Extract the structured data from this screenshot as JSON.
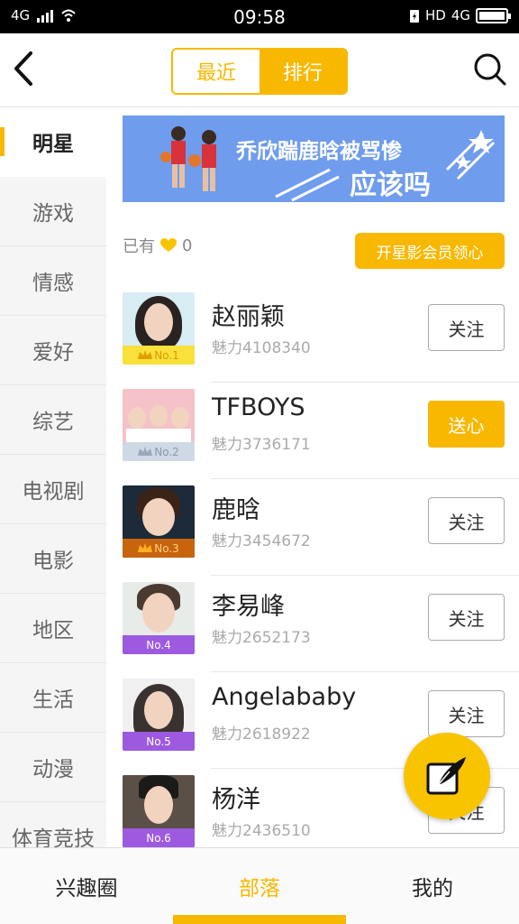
{
  "status_bar": {
    "network": "4G",
    "time": "09:58",
    "hd": "HD",
    "network_right": "4G"
  },
  "header": {
    "segments": [
      {
        "label": "最近",
        "active": false
      },
      {
        "label": "排行",
        "active": true
      }
    ],
    "icons": [
      "back-arrow-icon",
      "search-icon"
    ]
  },
  "sidebar": {
    "categories": [
      {
        "label": "明星",
        "active": true
      },
      {
        "label": "游戏"
      },
      {
        "label": "情感"
      },
      {
        "label": "爱好"
      },
      {
        "label": "综艺"
      },
      {
        "label": "电视剧"
      },
      {
        "label": "电影"
      },
      {
        "label": "地区"
      },
      {
        "label": "生活"
      },
      {
        "label": "动漫"
      },
      {
        "label": "体育竞技"
      }
    ]
  },
  "banner": {
    "line1": "乔欣踹鹿晗被骂惨",
    "line2": "应该吗"
  },
  "hearts": {
    "prefix": "已有",
    "count": "0",
    "vip_button": "开星影会员领心"
  },
  "ranking": [
    {
      "rank": "No.1",
      "name": "赵丽颖",
      "score": "魅力4108340",
      "action": "关注",
      "badge_color": "#f9e03a",
      "rank_text_color": "#d99a00"
    },
    {
      "rank": "No.2",
      "name": "TFBOYS",
      "score": "魅力3736171",
      "action": "送心",
      "badge_color": "#cfd9e6",
      "rank_text_color": "#8a98aa"
    },
    {
      "rank": "No.3",
      "name": "鹿晗",
      "score": "魅力3454672",
      "action": "关注",
      "badge_color": "#c8640e",
      "rank_text_color": "#ffd27a"
    },
    {
      "rank": "No.4",
      "name": "李易峰",
      "score": "魅力2652173",
      "action": "关注",
      "badge_color": "#9d5ae0",
      "rank_text_color": "#ffffff"
    },
    {
      "rank": "No.5",
      "name": "Angelababy",
      "score": "魅力2618922",
      "action": "关注",
      "badge_color": "#9d5ae0",
      "rank_text_color": "#ffffff"
    },
    {
      "rank": "No.6",
      "name": "杨洋",
      "score": "魅力2436510",
      "action": "关注",
      "badge_color": "#9d5ae0",
      "rank_text_color": "#ffffff"
    }
  ],
  "bottom_nav": [
    {
      "label": "兴趣圈"
    },
    {
      "label": "部落",
      "active": true
    },
    {
      "label": "我的"
    }
  ],
  "colors": {
    "accent": "#f8b800",
    "banner_bg": "#6f9cec"
  }
}
